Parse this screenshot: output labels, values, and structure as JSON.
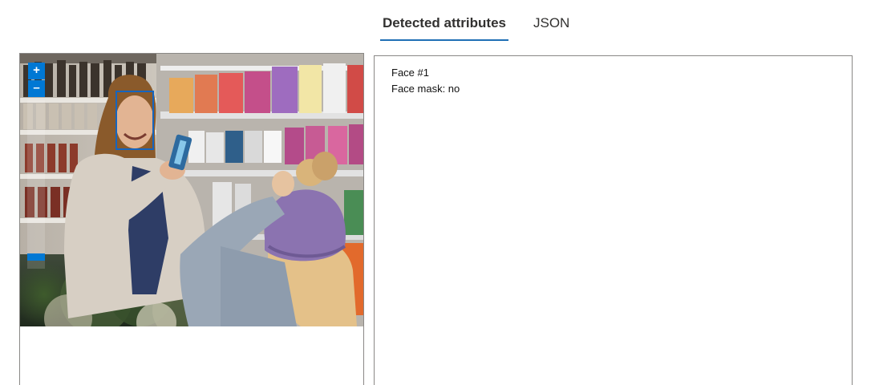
{
  "tabs": [
    {
      "label": "Detected attributes",
      "active": true
    },
    {
      "label": "JSON",
      "active": false
    }
  ],
  "zoom": {
    "zoom_in_label": "+",
    "zoom_out_label": "–",
    "level": 0.05
  },
  "image": {
    "faces_detected": 1
  },
  "attributes": {
    "face_title": "Face #1",
    "mask_line": "Face mask: no"
  },
  "colors": {
    "accent": "#0078d4",
    "tab_underline": "#1f6fb5",
    "face_box": "#1565c0",
    "border": "#8a8886"
  }
}
